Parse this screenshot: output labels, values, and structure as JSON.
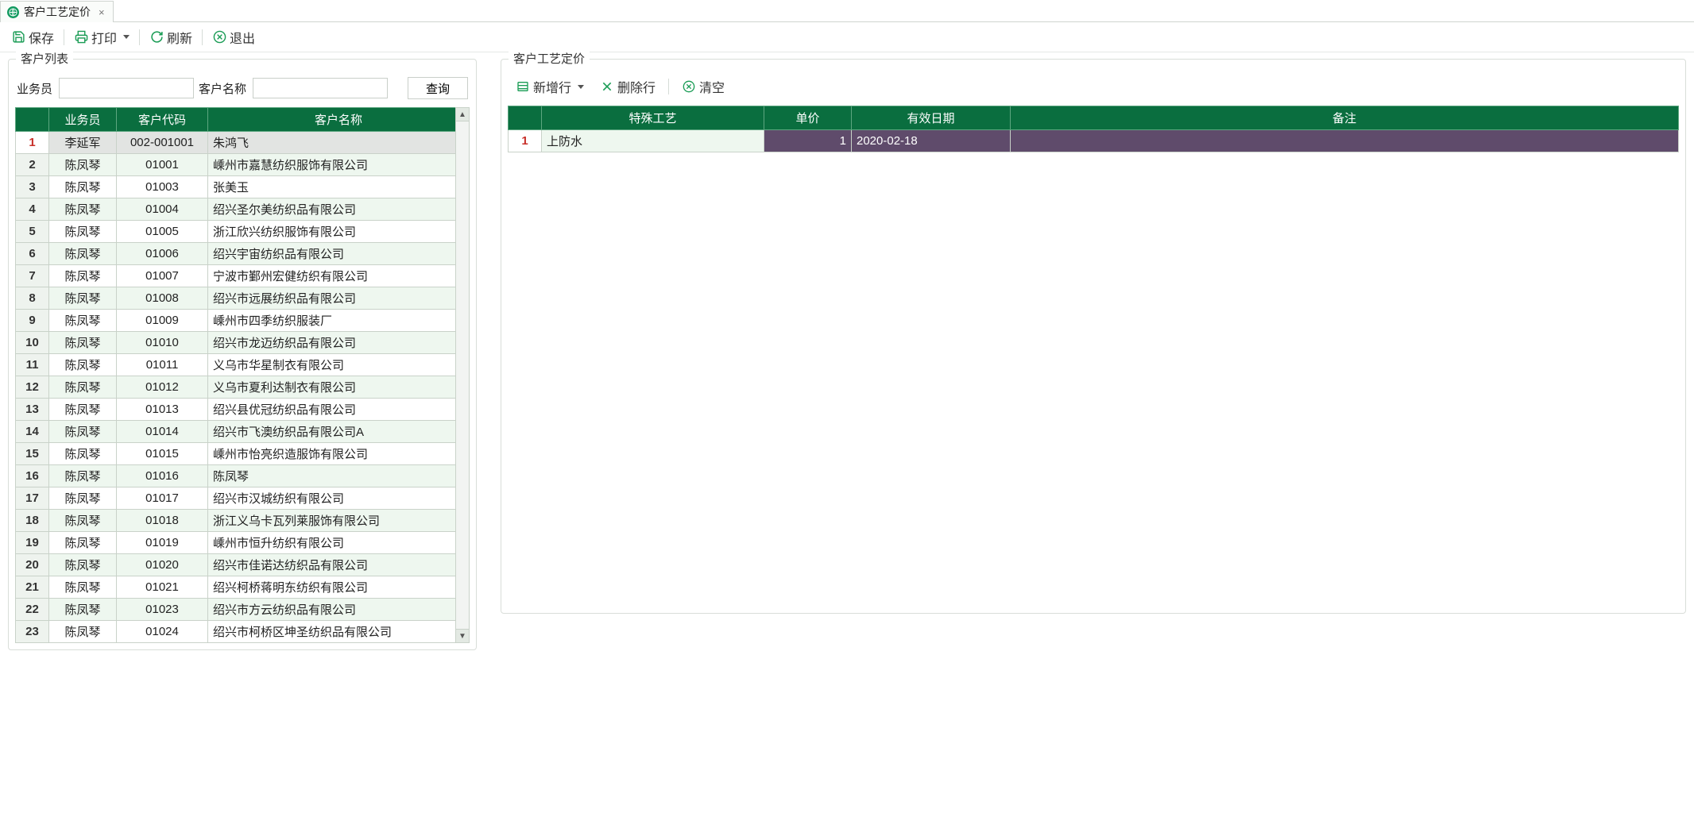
{
  "tab": {
    "title": "客户工艺定价"
  },
  "toolbar": {
    "save": "保存",
    "print": "打印",
    "refresh": "刷新",
    "exit": "退出"
  },
  "left": {
    "panel_title": "客户列表",
    "label_sales": "业务员",
    "label_customer": "客户名称",
    "btn_query": "查询",
    "columns": {
      "sales": "业务员",
      "code": "客户代码",
      "name": "客户名称"
    },
    "rows": [
      {
        "sales": "李延军",
        "code": "002-001001",
        "name": "朱鸿飞"
      },
      {
        "sales": "陈凤琴",
        "code": "01001",
        "name": "嵊州市嘉慧纺织服饰有限公司"
      },
      {
        "sales": "陈凤琴",
        "code": "01003",
        "name": "张美玉"
      },
      {
        "sales": "陈凤琴",
        "code": "01004",
        "name": "绍兴圣尔美纺织品有限公司"
      },
      {
        "sales": "陈凤琴",
        "code": "01005",
        "name": "浙江欣兴纺织服饰有限公司"
      },
      {
        "sales": "陈凤琴",
        "code": "01006",
        "name": "绍兴宇宙纺织品有限公司"
      },
      {
        "sales": "陈凤琴",
        "code": "01007",
        "name": "宁波市鄞州宏健纺织有限公司"
      },
      {
        "sales": "陈凤琴",
        "code": "01008",
        "name": "绍兴市远展纺织品有限公司"
      },
      {
        "sales": "陈凤琴",
        "code": "01009",
        "name": "嵊州市四季纺织服装厂"
      },
      {
        "sales": "陈凤琴",
        "code": "01010",
        "name": "绍兴市龙迈纺织品有限公司"
      },
      {
        "sales": "陈凤琴",
        "code": "01011",
        "name": "义乌市华星制衣有限公司"
      },
      {
        "sales": "陈凤琴",
        "code": "01012",
        "name": "义乌市夏利达制衣有限公司"
      },
      {
        "sales": "陈凤琴",
        "code": "01013",
        "name": "绍兴县优冠纺织品有限公司"
      },
      {
        "sales": "陈凤琴",
        "code": "01014",
        "name": "绍兴市飞澳纺织品有限公司A"
      },
      {
        "sales": "陈凤琴",
        "code": "01015",
        "name": "嵊州市怡亮织造服饰有限公司"
      },
      {
        "sales": "陈凤琴",
        "code": "01016",
        "name": "陈凤琴"
      },
      {
        "sales": "陈凤琴",
        "code": "01017",
        "name": "绍兴市汉城纺织有限公司"
      },
      {
        "sales": "陈凤琴",
        "code": "01018",
        "name": "浙江义乌卡瓦列莱服饰有限公司"
      },
      {
        "sales": "陈凤琴",
        "code": "01019",
        "name": "嵊州市恒升纺织有限公司"
      },
      {
        "sales": "陈凤琴",
        "code": "01020",
        "name": "绍兴市佳诺达纺织品有限公司"
      },
      {
        "sales": "陈凤琴",
        "code": "01021",
        "name": "绍兴柯桥蒋明东纺织有限公司"
      },
      {
        "sales": "陈凤琴",
        "code": "01023",
        "name": "绍兴市方云纺织品有限公司"
      },
      {
        "sales": "陈凤琴",
        "code": "01024",
        "name": "绍兴市柯桥区坤圣纺织品有限公司"
      }
    ],
    "selected_index": 0
  },
  "right": {
    "panel_title": "客户工艺定价",
    "toolbar": {
      "add": "新增行",
      "delete": "删除行",
      "clear": "清空"
    },
    "columns": {
      "process": "特殊工艺",
      "price": "单价",
      "date": "有效日期",
      "note": "备注"
    },
    "rows": [
      {
        "process": "上防水",
        "price": "1",
        "date": "2020-02-18",
        "note": ""
      }
    ],
    "selected_index": 0
  },
  "colors": {
    "header_green": "#0a6e3f",
    "selected_purple": "#5f4b6b"
  }
}
